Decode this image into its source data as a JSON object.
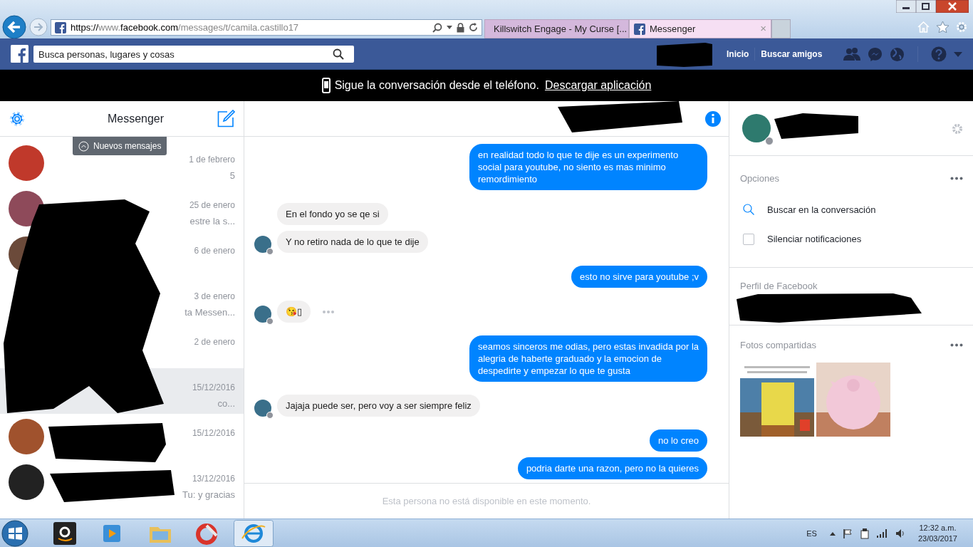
{
  "browser": {
    "url": [
      {
        "text": "https://",
        "dim": false
      },
      {
        "text": "www.",
        "dim": true
      },
      {
        "text": "facebook.com",
        "dim": false
      },
      {
        "text": "/messages/t/camila.castillo17",
        "dim": true
      }
    ],
    "tabs": [
      {
        "title": "Killswitch Engage - My Curse [...",
        "kind": "video",
        "selected": false
      },
      {
        "title": "Messenger",
        "kind": "facebook",
        "selected": true,
        "close_label": "×"
      }
    ]
  },
  "topbar": {
    "search_placeholder": "Busca personas, lugares y cosas",
    "nav": [
      "Inicio",
      "Buscar amigos"
    ]
  },
  "banner": {
    "text": "Sigue la conversación desde el teléfono.",
    "link": "Descargar aplicación"
  },
  "sidebar": {
    "title": "Messenger",
    "new_messages": "Nuevos mensajes",
    "conversations": [
      {
        "date": "1 de febrero",
        "snippet": "5",
        "selected": false,
        "color": "#c0392b"
      },
      {
        "date": "25 de enero",
        "snippet": "estre la s...",
        "selected": false,
        "color": "#8e4a5a"
      },
      {
        "date": "6 de enero",
        "selected": false,
        "color": "#6b4a3a"
      },
      {
        "date": "3 de enero",
        "snippet": "ta Messen...",
        "selected": false
      },
      {
        "date": "2 de enero",
        "selected": false
      },
      {
        "date": "15/12/2016",
        "snippet": "co...",
        "selected": true
      },
      {
        "date": "15/12/2016",
        "selected": false,
        "color": "#a0522d"
      },
      {
        "date": "13/12/2016",
        "snippet": "Tu: y gracias",
        "selected": false,
        "color": "#222222"
      }
    ]
  },
  "conversation": {
    "messages": [
      {
        "kind": "outgoing",
        "text": "en realidad todo lo que te dije es un experimento social para youtube, no siento es mas minimo remordimiento",
        "avatar": false,
        "more": false
      },
      {
        "kind": "incoming",
        "text": "En el fondo yo se qe si",
        "avatar": false,
        "more": false
      },
      {
        "kind": "incoming",
        "text": "Y no retiro nada de lo que te dije",
        "avatar": true,
        "more": false
      },
      {
        "kind": "outgoing",
        "text": "esto no sirve para youtube ;v",
        "avatar": false,
        "more": false
      },
      {
        "kind": "incoming",
        "text": "😘▯",
        "avatar": true,
        "more": true
      },
      {
        "kind": "outgoing",
        "text": "seamos sinceros me odias, pero estas invadida por la alegria de haberte graduado y la emocion de despedirte y empezar lo que te gusta",
        "avatar": false,
        "more": false
      },
      {
        "kind": "incoming",
        "text": "Jajaja puede ser, pero voy a ser siempre feliz",
        "avatar": true,
        "more": false
      },
      {
        "kind": "outgoing",
        "text": "no lo creo",
        "avatar": false,
        "more": false
      },
      {
        "kind": "outgoing",
        "text": "podria darte una razon, pero no la quieres",
        "avatar": false,
        "more": false
      }
    ],
    "composer_placeholder": "Esta persona no está disponible en este momento."
  },
  "details": {
    "options_title": "Opciones",
    "options": [
      {
        "kind": "search",
        "label": "Buscar en la conversación"
      },
      {
        "kind": "checkbox",
        "label": "Silenciar notificaciones",
        "checked": false
      }
    ],
    "profile_title": "Perfil de Facebook",
    "photos_title": "Fotos compartidas"
  },
  "taskbar": {
    "language": "ES",
    "time": "12:32 a.m.",
    "date": "23/03/2017"
  }
}
